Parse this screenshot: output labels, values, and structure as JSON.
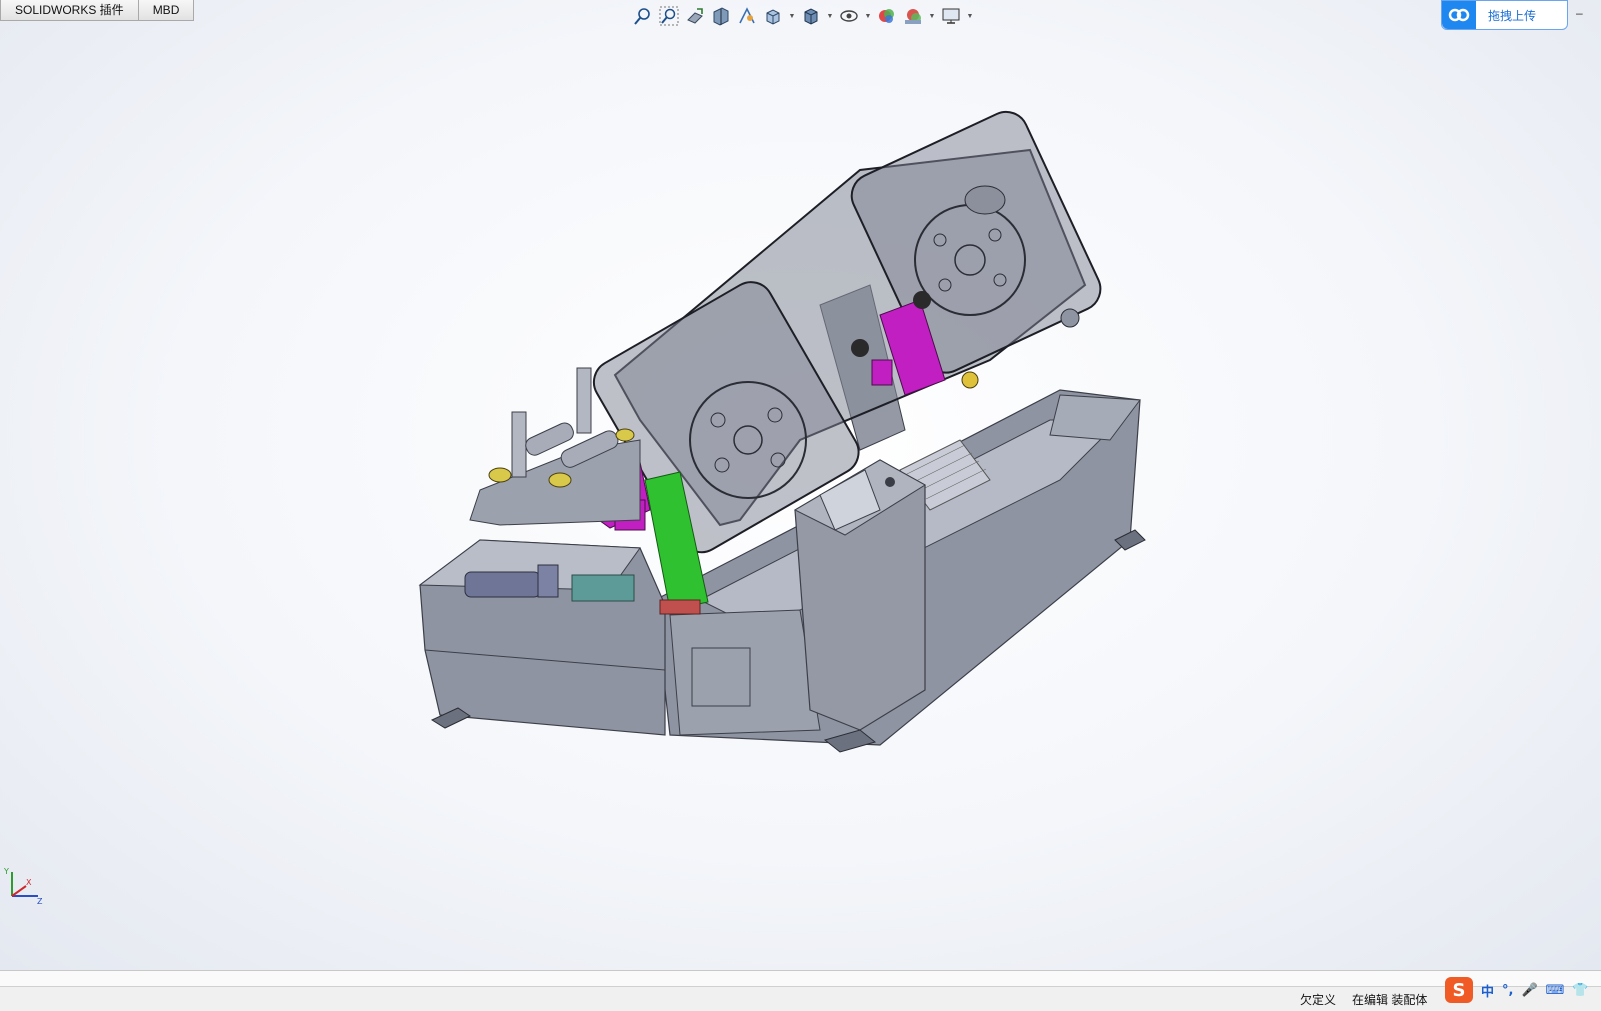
{
  "tabs": [
    {
      "label": "SOLIDWORKS 插件"
    },
    {
      "label": "MBD"
    }
  ],
  "heads_up_toolbar": [
    {
      "icon": "zoom-to-fit-icon"
    },
    {
      "icon": "zoom-to-area-icon"
    },
    {
      "icon": "previous-view-icon"
    },
    {
      "icon": "section-view-icon"
    },
    {
      "icon": "dynamic-annotation-icon"
    },
    {
      "icon": "view-orientation-icon",
      "dropdown": true
    },
    {
      "icon": "display-style-icon",
      "dropdown": true
    },
    {
      "icon": "hide-show-items-icon",
      "dropdown": true
    },
    {
      "icon": "edit-appearance-icon"
    },
    {
      "icon": "apply-scene-icon",
      "dropdown": true
    },
    {
      "icon": "view-settings-icon",
      "dropdown": true
    }
  ],
  "upload_widget": {
    "label": "拖拽上传",
    "icon": "baidu-netdisk-icon"
  },
  "window_controls": {
    "minimize": "–"
  },
  "triad": {
    "x": "X",
    "y": "Y",
    "z": "Z"
  },
  "status": {
    "definition": "欠定义",
    "mode": "在编辑 装配体"
  },
  "ime": {
    "logo": "S",
    "items": [
      "中",
      "°,",
      "🎤",
      "⌨",
      "👕"
    ]
  },
  "colors": {
    "accent": "#1e88f0",
    "model_body": "#8f94a3",
    "model_dark": "#6c7180",
    "highlight_magenta": "#c21fc2",
    "highlight_green": "#2fc12f",
    "ime_orange": "#f05a24"
  }
}
